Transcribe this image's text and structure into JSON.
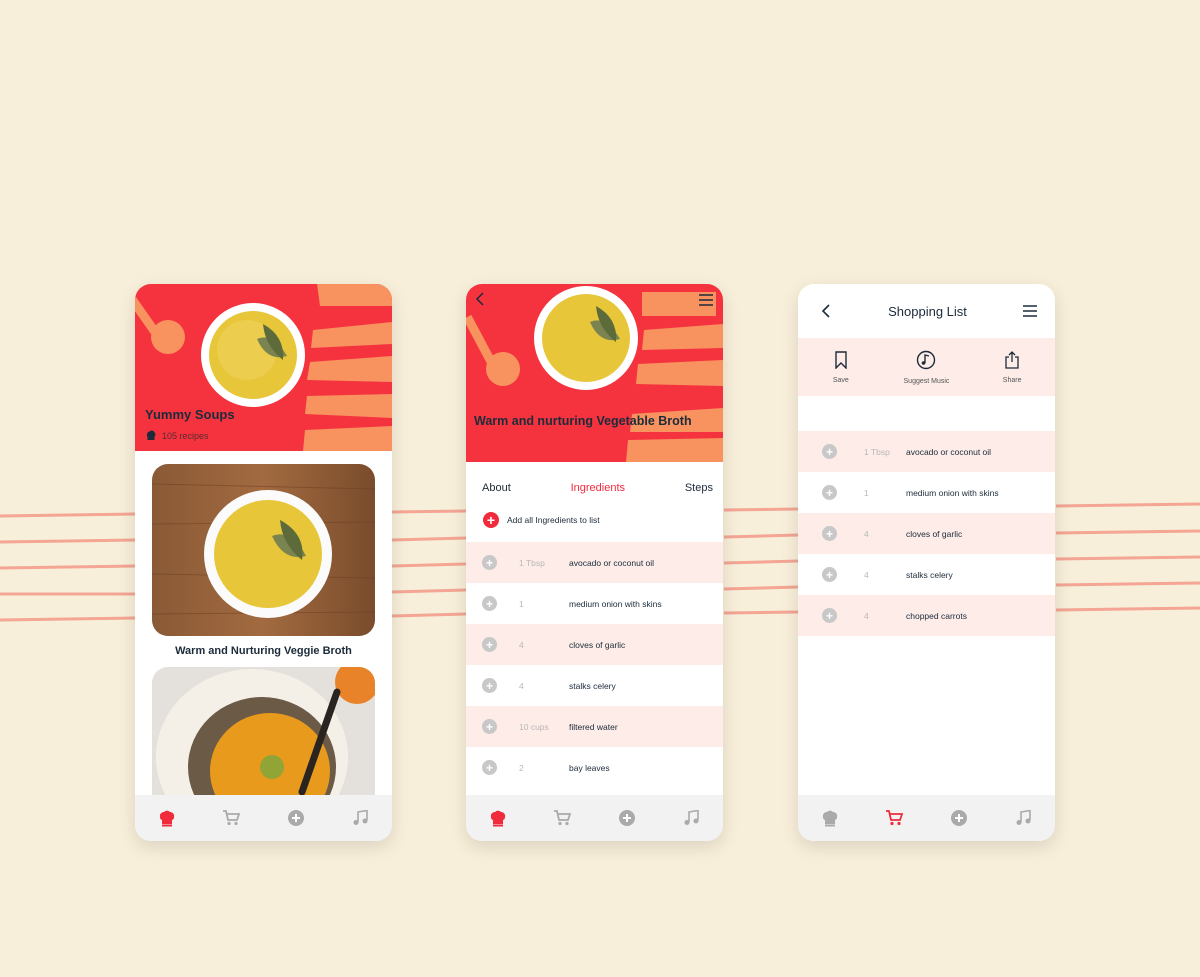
{
  "screen1": {
    "hero_title": "Yummy Soups",
    "recipe_count": "105 recipes",
    "cards": [
      {
        "title": "Warm and Nurturing Veggie Broth"
      }
    ]
  },
  "screen2": {
    "hero_title": "Warm and nurturing Vegetable Broth",
    "tabs": [
      {
        "label": "About"
      },
      {
        "label": "Ingredients"
      },
      {
        "label": "Steps"
      }
    ],
    "add_all_label": "Add all Ingredients to list",
    "ingredients": [
      {
        "qty": "1 Tbsp",
        "name": "avocado or coconut oil"
      },
      {
        "qty": "1",
        "name": "medium onion with skins"
      },
      {
        "qty": "4",
        "name": "cloves of garlic"
      },
      {
        "qty": "4",
        "name": "stalks celery"
      },
      {
        "qty": "10 cups",
        "name": "filtered water"
      },
      {
        "qty": "2",
        "name": "bay leaves"
      }
    ]
  },
  "screen3": {
    "title": "Shopping List",
    "actions": [
      {
        "label": "Save",
        "icon": "bookmark-icon"
      },
      {
        "label": "Suggest Music",
        "icon": "music-disc-icon"
      },
      {
        "label": "Share",
        "icon": "share-icon"
      }
    ],
    "items": [
      {
        "qty": "1 Tbsp",
        "name": "avocado or coconut oil"
      },
      {
        "qty": "1",
        "name": "medium onion with skins"
      },
      {
        "qty": "4",
        "name": "cloves of garlic"
      },
      {
        "qty": "4",
        "name": "stalks celery"
      },
      {
        "qty": "4",
        "name": "chopped carrots"
      }
    ]
  },
  "nav": {
    "icons": [
      "chef-hat-icon",
      "cart-icon",
      "plus-circle-icon",
      "music-note-icon"
    ]
  },
  "colors": {
    "accent": "#f5333f",
    "orange": "#f8925f",
    "row_tint": "#fdece8",
    "background": "#f8efda",
    "stripe": "#f4a594"
  }
}
